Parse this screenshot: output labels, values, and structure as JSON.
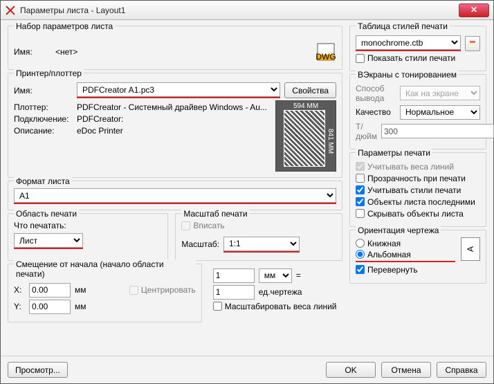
{
  "window": {
    "title": "Параметры листа - Layout1"
  },
  "pageset": {
    "group": "Набор параметров листа",
    "name_lbl": "Имя:",
    "name_val": "<нет>"
  },
  "plotstyle": {
    "group": "Таблица стилей печати",
    "value": "monochrome.ctb",
    "show_lbl": "Показать стили печати"
  },
  "printer": {
    "group": "Принтер/плоттер",
    "name_lbl": "Имя:",
    "name_val": "PDFCreator A1.pc3",
    "props_btn": "Свойства",
    "plotter_lbl": "Плоттер:",
    "plotter_val": "PDFCreator - Системный драйвер Windows - Au...",
    "conn_lbl": "Подключение:",
    "conn_val": "PDFCreator:",
    "desc_lbl": "Описание:",
    "desc_val": "eDoc Printer",
    "preview_w": "594 MM",
    "preview_h": "841 MM"
  },
  "viewports": {
    "group": "ВЭкраны с тонированием",
    "method_lbl": "Способ вывода",
    "method_val": "Как на экране",
    "quality_lbl": "Качество",
    "quality_val": "Нормальное",
    "dpi_lbl": "Т/дюйм",
    "dpi_val": "300"
  },
  "paper": {
    "group": "Формат листа",
    "value": "A1"
  },
  "plotopts": {
    "group": "Параметры печати",
    "opt1": "Учитывать веса линий",
    "opt2": "Прозрачность при печати",
    "opt3": "Учитывать стили печати",
    "opt4": "Объекты листа последними",
    "opt5": "Скрывать объекты листа"
  },
  "area": {
    "group": "Область печати",
    "what_lbl": "Что печатать:",
    "what_val": "Лист"
  },
  "scale": {
    "group": "Масштаб печати",
    "fit_lbl": "Вписать",
    "scale_lbl": "Масштаб:",
    "scale_val": "1:1",
    "num_val": "1",
    "unit_val": "мм",
    "equals": "=",
    "den_val": "1",
    "den_unit": "ед.чертежа",
    "scale_lw": "Масштабировать веса линий"
  },
  "offset": {
    "group": "Смещение от начала (начало области печати)",
    "x_lbl": "X:",
    "x_val": "0.00",
    "x_unit": "мм",
    "y_lbl": "Y:",
    "y_val": "0.00",
    "y_unit": "мм",
    "center_lbl": "Центрировать"
  },
  "orient": {
    "group": "Ориентация чертежа",
    "portrait": "Книжная",
    "landscape": "Альбомная",
    "upside": "Перевернуть",
    "glyph": "A"
  },
  "buttons": {
    "preview": "Просмотр...",
    "ok": "OK",
    "cancel": "Отмена",
    "help": "Справка"
  }
}
